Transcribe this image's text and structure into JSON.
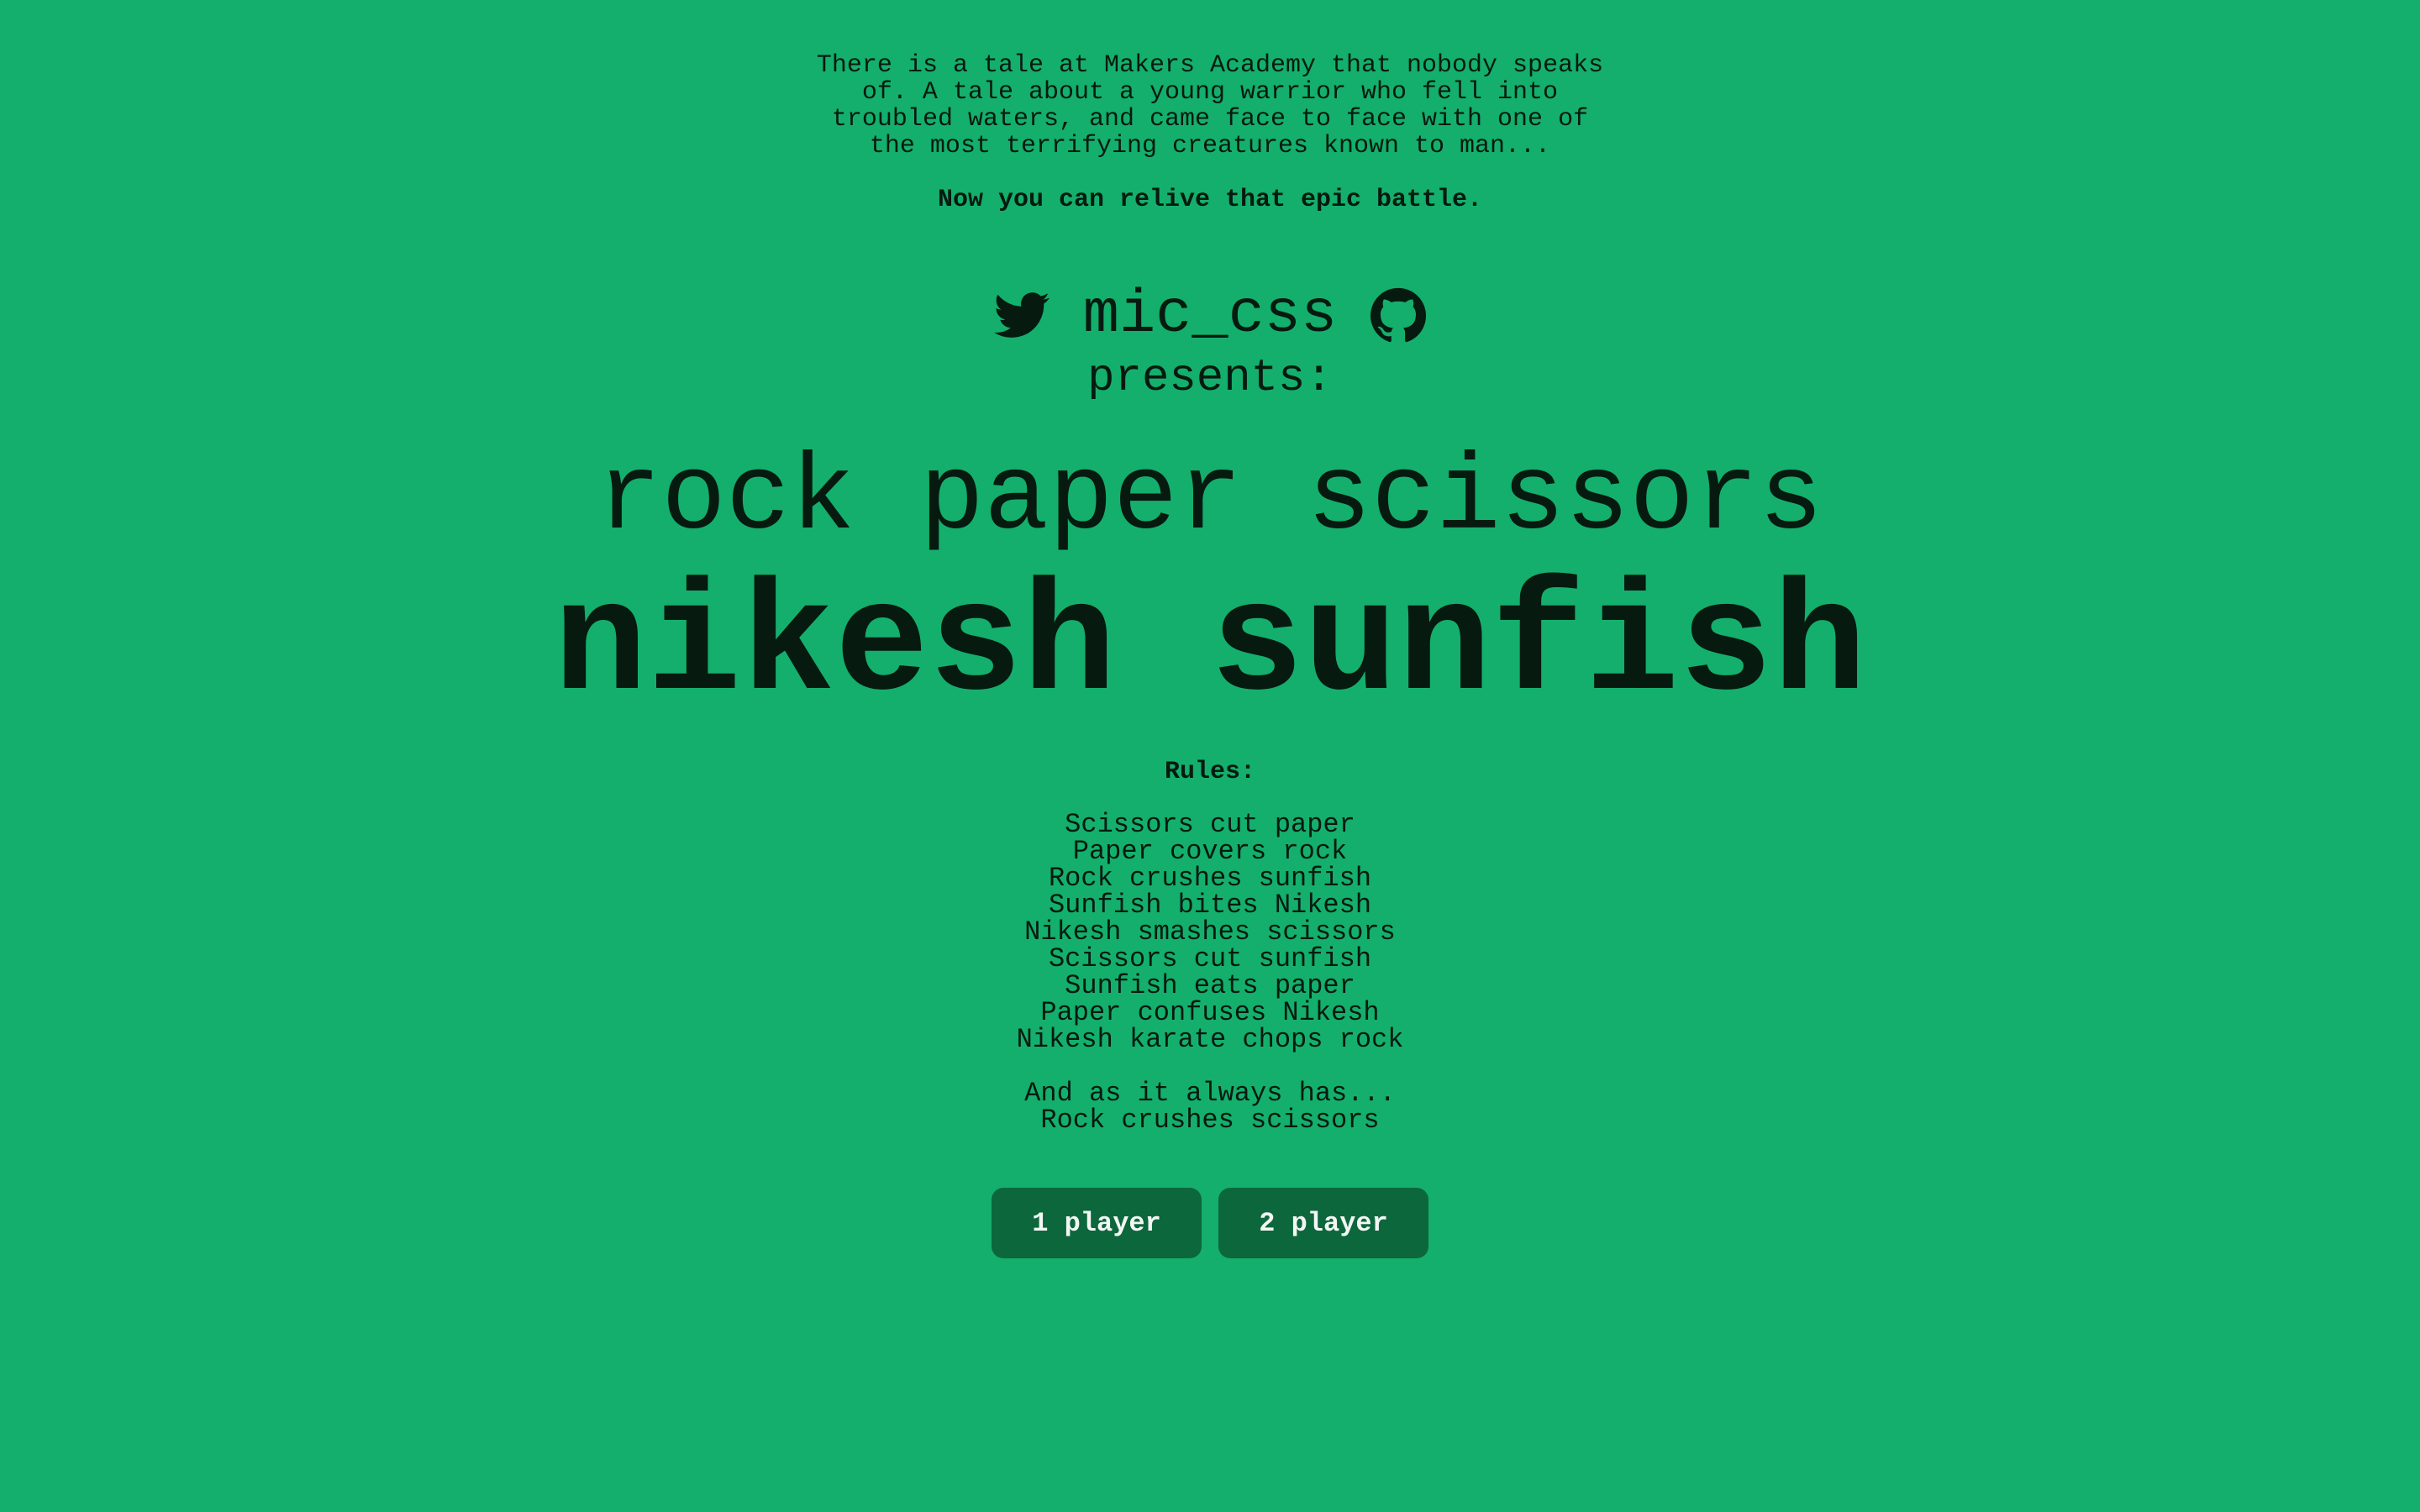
{
  "intro": {
    "lines": [
      "There is a tale at Makers Academy that nobody speaks",
      "of. A tale about a young warrior who fell into",
      "troubled waters, and came face to face with one of",
      "the most terrifying creatures known to man..."
    ],
    "tagline": "Now you can relive that epic battle."
  },
  "brand": {
    "left_icon": "twitter-bird-icon",
    "handle": "mic_css",
    "right_icon": "github-octocat-icon",
    "presents": "presents:"
  },
  "titles": {
    "small": "rock paper scissors",
    "big": "nikesh sunfish"
  },
  "rules": {
    "heading": "Rules:",
    "items": [
      "Scissors cut paper",
      "Paper covers rock",
      "Rock crushes sunfish",
      "Sunfish bites Nikesh",
      "Nikesh smashes scissors",
      "Scissors cut sunfish",
      "Sunfish eats paper",
      "Paper confuses Nikesh",
      "Nikesh karate chops rock"
    ],
    "finale": [
      "And as it always has...",
      "Rock crushes scissors"
    ]
  },
  "buttons": {
    "one_player": "1 player",
    "two_player": "2 player"
  },
  "colors": {
    "background": "#14af6c",
    "text": "#061a10",
    "button": "#0c673d",
    "button_text": "#f3f6f3"
  }
}
